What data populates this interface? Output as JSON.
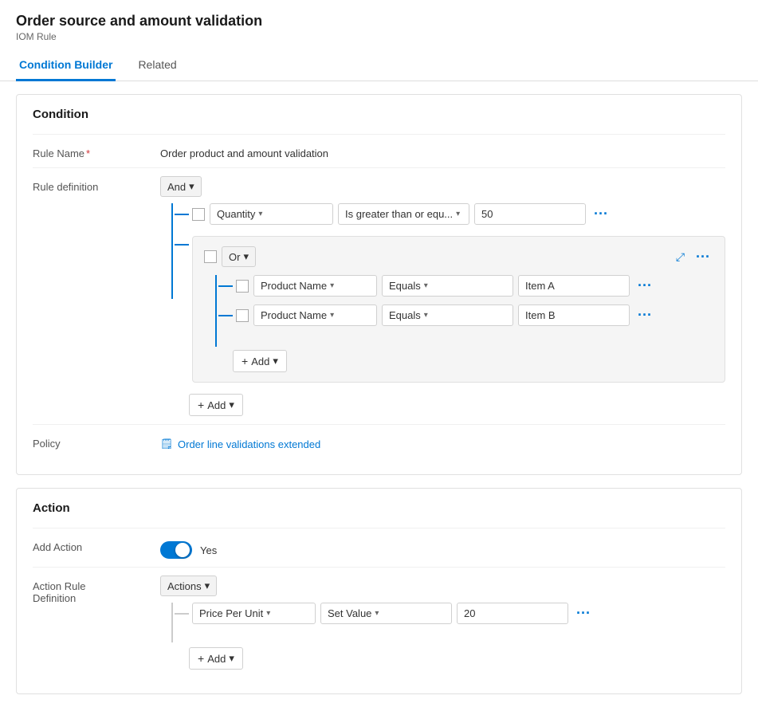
{
  "page": {
    "title": "Order source and amount validation",
    "subtitle": "IOM Rule"
  },
  "tabs": [
    {
      "id": "condition-builder",
      "label": "Condition Builder",
      "active": true
    },
    {
      "id": "related",
      "label": "Related",
      "active": false
    }
  ],
  "condition_section": {
    "title": "Condition",
    "rule_name_label": "Rule Name",
    "rule_name_required": "*",
    "rule_name_value": "Order product and amount validation",
    "rule_definition_label": "Rule definition",
    "top_operator": "And",
    "top_condition": {
      "field": "Quantity",
      "operator": "Is greater than or equ...",
      "value": "50"
    },
    "or_group": {
      "operator": "Or",
      "conditions": [
        {
          "field": "Product Name",
          "operator": "Equals",
          "value": "Item A"
        },
        {
          "field": "Product Name",
          "operator": "Equals",
          "value": "Item B"
        }
      ],
      "add_label": "Add"
    },
    "add_label": "Add",
    "policy_label": "Policy",
    "policy_link_text": "Order line validations extended",
    "policy_link_icon": "📄"
  },
  "action_section": {
    "title": "Action",
    "add_action_label": "Add Action",
    "toggle_value": true,
    "toggle_text": "Yes",
    "action_rule_label": "Action Rule\nDefinition",
    "actions_operator": "Actions",
    "action_row": {
      "field": "Price Per Unit",
      "operator": "Set Value",
      "value": "20"
    },
    "add_label": "Add"
  },
  "icons": {
    "chevron_down": "▾",
    "plus": "+",
    "more": "...",
    "collapse": "⤢",
    "policy": "🗒"
  }
}
